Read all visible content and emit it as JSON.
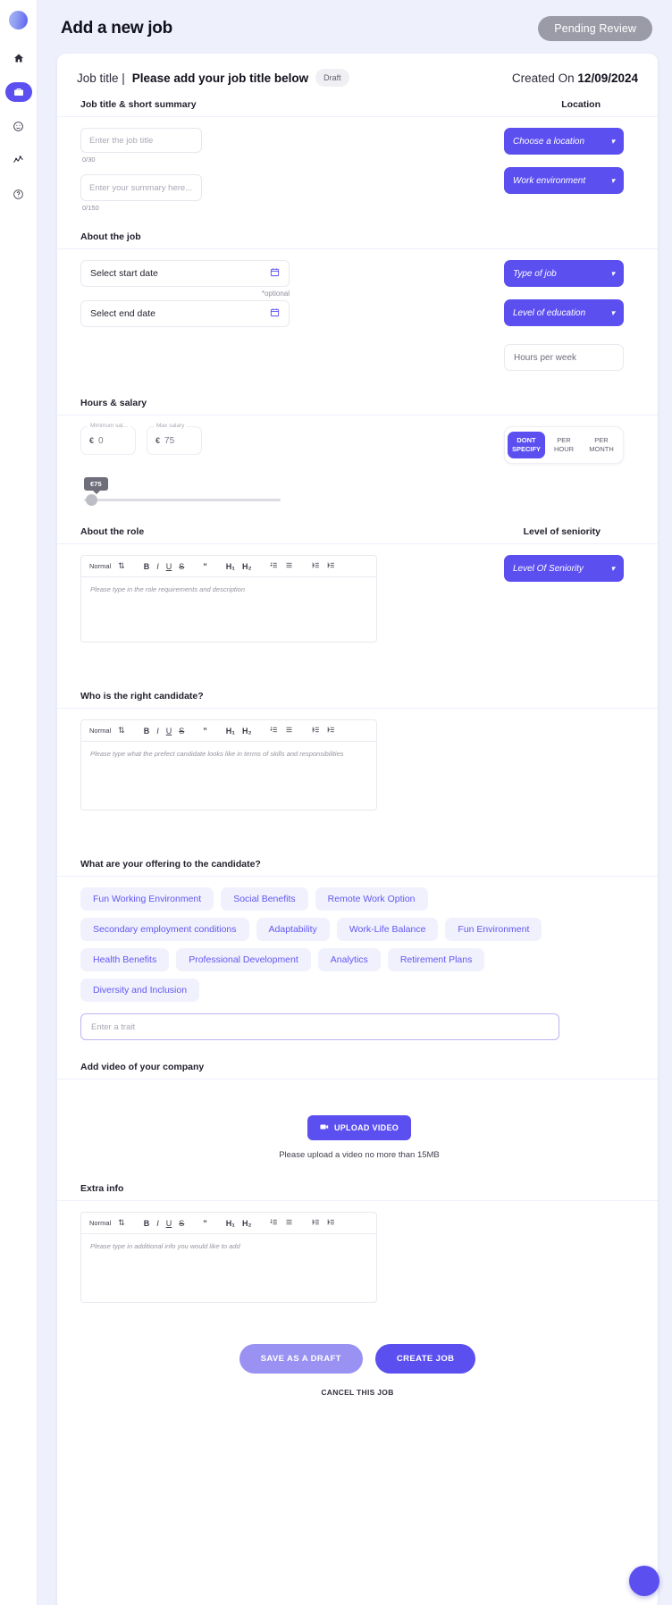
{
  "sidebar": {
    "logo_name": "app-logo",
    "items": [
      {
        "icon": "home-icon",
        "label": "Home",
        "active": false
      },
      {
        "icon": "briefcase-icon",
        "label": "Jobs",
        "active": true
      },
      {
        "icon": "smiley-icon",
        "label": "Candidates",
        "active": false
      },
      {
        "icon": "analytics-icon",
        "label": "Analytics",
        "active": false
      },
      {
        "icon": "help-icon",
        "label": "Help",
        "active": false
      }
    ]
  },
  "header": {
    "title": "Add a new job",
    "status": "Pending Review"
  },
  "card_head": {
    "job_title_label": "Job title |",
    "job_title_value": "Please add your job title below",
    "draft_pill": "Draft",
    "created_label": "Created On",
    "created_date": "12/09/2024"
  },
  "sections": {
    "summary": {
      "title": "Job title & short summary",
      "right_title": "Location",
      "job_title_placeholder": "Enter the job title",
      "job_title_counter": "0/30",
      "summary_placeholder": "Enter your summary here...",
      "summary_counter": "0/150",
      "location_select": "Choose a location",
      "work_env_select": "Work environment"
    },
    "about_job": {
      "title": "About the job",
      "start_date": "Select start date",
      "optional_note": "*optional",
      "end_date": "Select end date",
      "type_of_job": "Type of job",
      "level_of_education": "Level of education",
      "hours_per_week": "Hours per week"
    },
    "hours_salary": {
      "title": "Hours & salary",
      "min_legend": "Minimum sal...",
      "min_currency": "€",
      "min_value": "0",
      "max_legend": "Max salary",
      "max_currency": "€",
      "max_value": "75",
      "segments": [
        {
          "line1": "DONT",
          "line2": "SPECIFY",
          "active": true
        },
        {
          "line1": "PER",
          "line2": "HOUR",
          "active": false
        },
        {
          "line1": "PER",
          "line2": "MONTH",
          "active": false
        }
      ],
      "slider_tooltip": "€75",
      "slider_value": 75
    },
    "about_role": {
      "title": "About the role",
      "right_title": "Level of seniority",
      "editor_placeholder": "Please type in the role requirements and description",
      "seniority_select": "Level Of Seniority"
    },
    "candidate": {
      "title": "Who is the right candidate?",
      "editor_placeholder": "Please type what the prefect candidate looks like in terms of skills and responsibilities"
    },
    "offering": {
      "title": "What are your offering to the candidate?",
      "chips": [
        "Fun Working Environment",
        "Social Benefits",
        "Remote Work Option",
        "Secondary employment conditions",
        "Adaptability",
        "Work-Life Balance",
        "Fun Environment",
        "Health Benefits",
        "Professional Development",
        "Analytics",
        "Retirement Plans",
        "Diversity and Inclusion"
      ],
      "trait_placeholder": "Enter a trait"
    },
    "video": {
      "title": "Add video of your company",
      "upload_label": "UPLOAD VIDEO",
      "note": "Please upload a video no more than 15MB"
    },
    "extra": {
      "title": "Extra info",
      "editor_placeholder": "Please type in additional info you would like to add"
    }
  },
  "editor_toolbar": {
    "format": "Normal",
    "bold": "B",
    "italic": "I",
    "underline": "U",
    "strike": "S",
    "quote": "”",
    "h1": "H₁",
    "h2": "H₂",
    "ordered_list": "≡",
    "bullet_list": "≡",
    "outdent": "≡",
    "indent": "≡"
  },
  "footer": {
    "save_draft": "SAVE AS A DRAFT",
    "create_job": "CREATE JOB",
    "cancel": "CANCEL THIS JOB"
  },
  "colors": {
    "accent": "#5b4ff0",
    "chip_bg": "#f0f1fd",
    "chip_text": "#6257f2",
    "page_bg": "#eef0fb",
    "badge_grey": "#9b9ba8"
  }
}
